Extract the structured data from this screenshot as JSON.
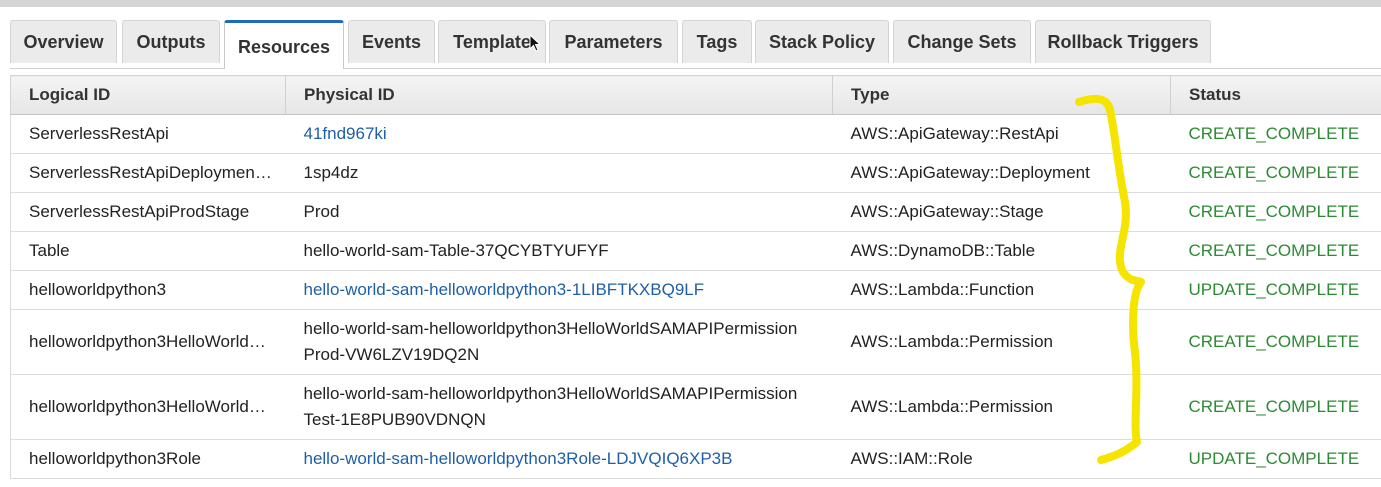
{
  "tabs": [
    {
      "label": "Overview"
    },
    {
      "label": "Outputs"
    },
    {
      "label": "Resources"
    },
    {
      "label": "Events"
    },
    {
      "label": "Template"
    },
    {
      "label": "Parameters"
    },
    {
      "label": "Tags"
    },
    {
      "label": "Stack Policy"
    },
    {
      "label": "Change Sets"
    },
    {
      "label": "Rollback Triggers"
    }
  ],
  "active_tab": "Resources",
  "table": {
    "headers": [
      "Logical ID",
      "Physical ID",
      "Type",
      "Status"
    ],
    "rows": [
      {
        "logical_id": "ServerlessRestApi",
        "physical_id": "41fnd967ki",
        "physical_is_link": true,
        "type": "AWS::ApiGateway::RestApi",
        "status": "CREATE_COMPLETE"
      },
      {
        "logical_id": "ServerlessRestApiDeploymen…",
        "physical_id": "1sp4dz",
        "physical_is_link": false,
        "type": "AWS::ApiGateway::Deployment",
        "status": "CREATE_COMPLETE"
      },
      {
        "logical_id": "ServerlessRestApiProdStage",
        "physical_id": "Prod",
        "physical_is_link": false,
        "type": "AWS::ApiGateway::Stage",
        "status": "CREATE_COMPLETE"
      },
      {
        "logical_id": "Table",
        "physical_id": "hello-world-sam-Table-37QCYBTYUFYF",
        "physical_is_link": false,
        "type": "AWS::DynamoDB::Table",
        "status": "CREATE_COMPLETE"
      },
      {
        "logical_id": "helloworldpython3",
        "physical_id": "hello-world-sam-helloworldpython3-1LIBFTKXBQ9LF",
        "physical_is_link": true,
        "type": "AWS::Lambda::Function",
        "status": "UPDATE_COMPLETE"
      },
      {
        "logical_id": "helloworldpython3HelloWorld…",
        "physical_id_line1": "hello-world-sam-helloworldpython3HelloWorldSAMAPIPermission",
        "physical_id_line2": "Prod-VW6LZV19DQ2N",
        "physical_is_link": false,
        "type": "AWS::Lambda::Permission",
        "status": "CREATE_COMPLETE"
      },
      {
        "logical_id": "helloworldpython3HelloWorld…",
        "physical_id_line1": "hello-world-sam-helloworldpython3HelloWorldSAMAPIPermission",
        "physical_id_line2": "Test-1E8PUB90VDNQN",
        "physical_is_link": false,
        "type": "AWS::Lambda::Permission",
        "status": "CREATE_COMPLETE"
      },
      {
        "logical_id": "helloworldpython3Role",
        "physical_id": "hello-world-sam-helloworldpython3Role-LDJVQIQ6XP3B",
        "physical_is_link": true,
        "type": "AWS::IAM::Role",
        "status": "UPDATE_COMPLETE"
      }
    ]
  },
  "colors": {
    "link": "#1f5fa7",
    "status_success": "#2c8a33",
    "active_tab_accent": "#1f6bb5",
    "annotation": "#f5e400"
  },
  "icons": {
    "cursor": "mouse-pointer-icon",
    "annotation": "yellow-brace-annotation"
  }
}
